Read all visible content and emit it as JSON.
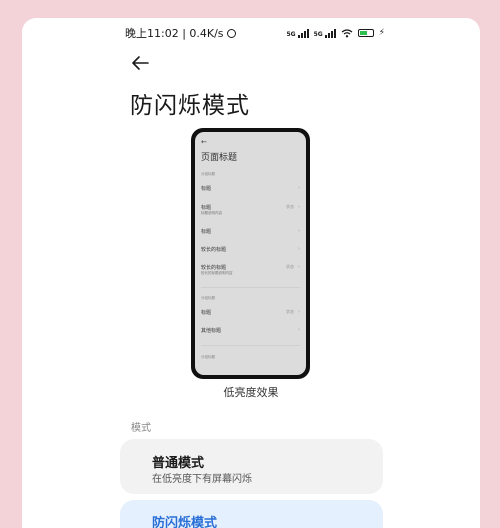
{
  "status_bar": {
    "time": "晚上11:02 | 0.4K/s",
    "signal_1": "5G",
    "signal_2": "5G",
    "battery_color": "#2fbf4f"
  },
  "header": {
    "back_icon": "arrow-left-icon",
    "title": "防闪烁模式"
  },
  "preview": {
    "title": "页面标题",
    "section_1": "分组标题",
    "section_2": "分组标题",
    "section_3": "分组标题",
    "rows": [
      {
        "label": "标题",
        "sub": "",
        "value": ""
      },
      {
        "label": "标题",
        "sub": "标题说明内容",
        "value": "状态"
      },
      {
        "label": "标题",
        "sub": "",
        "value": ""
      },
      {
        "label": "较长的标题",
        "sub": "",
        "value": ""
      },
      {
        "label": "较长的标题",
        "sub": "较长的标题说明内容",
        "value": "状态"
      },
      {
        "label": "标题",
        "sub": "",
        "value": "状态"
      },
      {
        "label": "其他标题",
        "sub": "",
        "value": ""
      }
    ],
    "caption": "低亮度效果"
  },
  "mode_section": {
    "label": "模式",
    "options": [
      {
        "title": "普通模式",
        "subtitle": "在低亮度下有屏幕闪烁"
      },
      {
        "title": "防闪烁模式",
        "subtitle": ""
      }
    ]
  },
  "colors": {
    "page_bg": "#f3d3d8",
    "accent": "#2a6fd6",
    "selected_card_bg": "#e4f0fd",
    "card_bg": "#f2f2f2"
  }
}
